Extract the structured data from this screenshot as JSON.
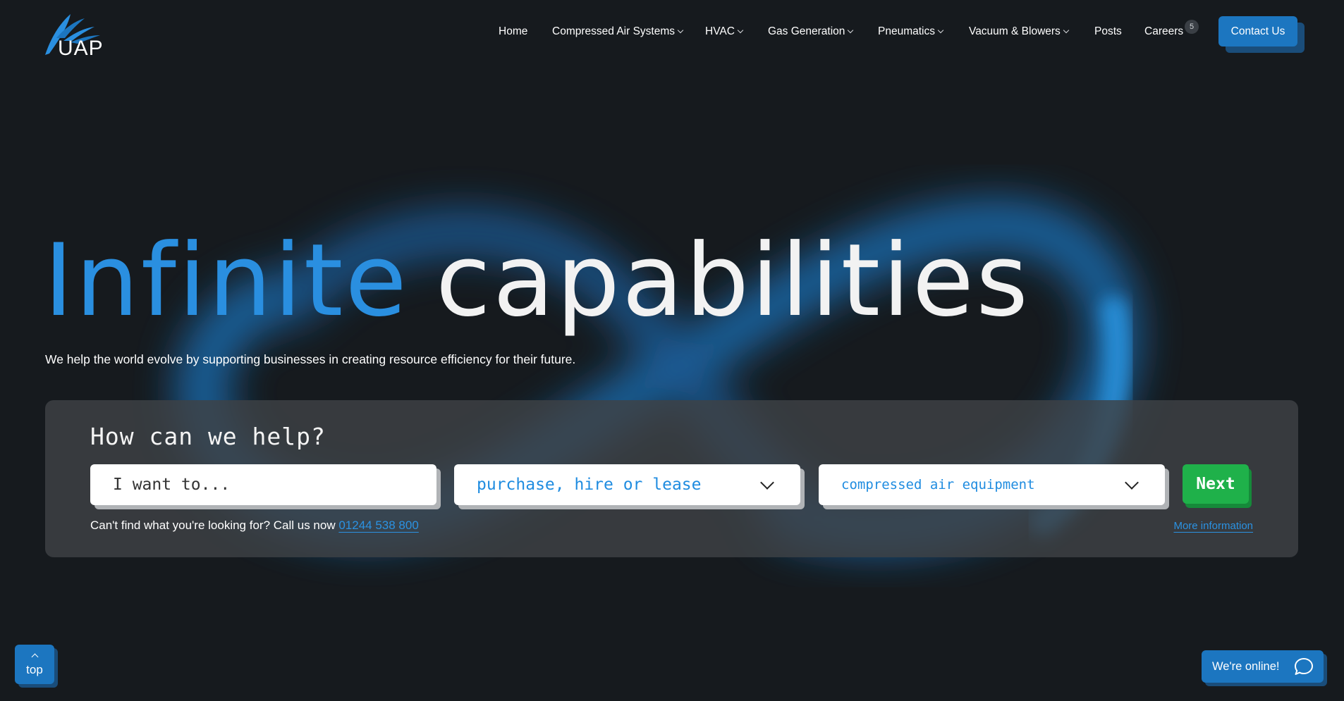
{
  "brand": {
    "logo_text": "UAP",
    "accent_color": "#2a8fe0",
    "cta_color": "#1c76c0",
    "next_color": "#1fb14a"
  },
  "nav": {
    "items": [
      {
        "label": "Home",
        "has_dropdown": false
      },
      {
        "label": "Compressed Air Systems",
        "has_dropdown": true
      },
      {
        "label": "HVAC",
        "has_dropdown": true
      },
      {
        "label": "Gas Generation",
        "has_dropdown": true
      },
      {
        "label": "Pneumatics",
        "has_dropdown": true
      },
      {
        "label": "Vacuum & Blowers",
        "has_dropdown": true
      },
      {
        "label": "Posts",
        "has_dropdown": false
      },
      {
        "label": "Careers",
        "has_dropdown": false
      }
    ],
    "careers_badge": "5",
    "contact_label": "Contact Us"
  },
  "hero": {
    "title_blue": "Infinite",
    "title_white": "capabilities",
    "subtitle": "We help the world evolve by supporting businesses in creating resource efficiency for their future."
  },
  "help": {
    "title": "How can we help?",
    "field1_value": "I want to...",
    "field2_value": "purchase, hire or lease",
    "field3_value": "compressed air equipment",
    "next_label": "Next",
    "footer_text": "Can't find what you're looking for? Call us now ",
    "phone": "01244 538 800",
    "more_info": "More information"
  },
  "widgets": {
    "top_label": "top",
    "chat_label": "We're online!"
  }
}
